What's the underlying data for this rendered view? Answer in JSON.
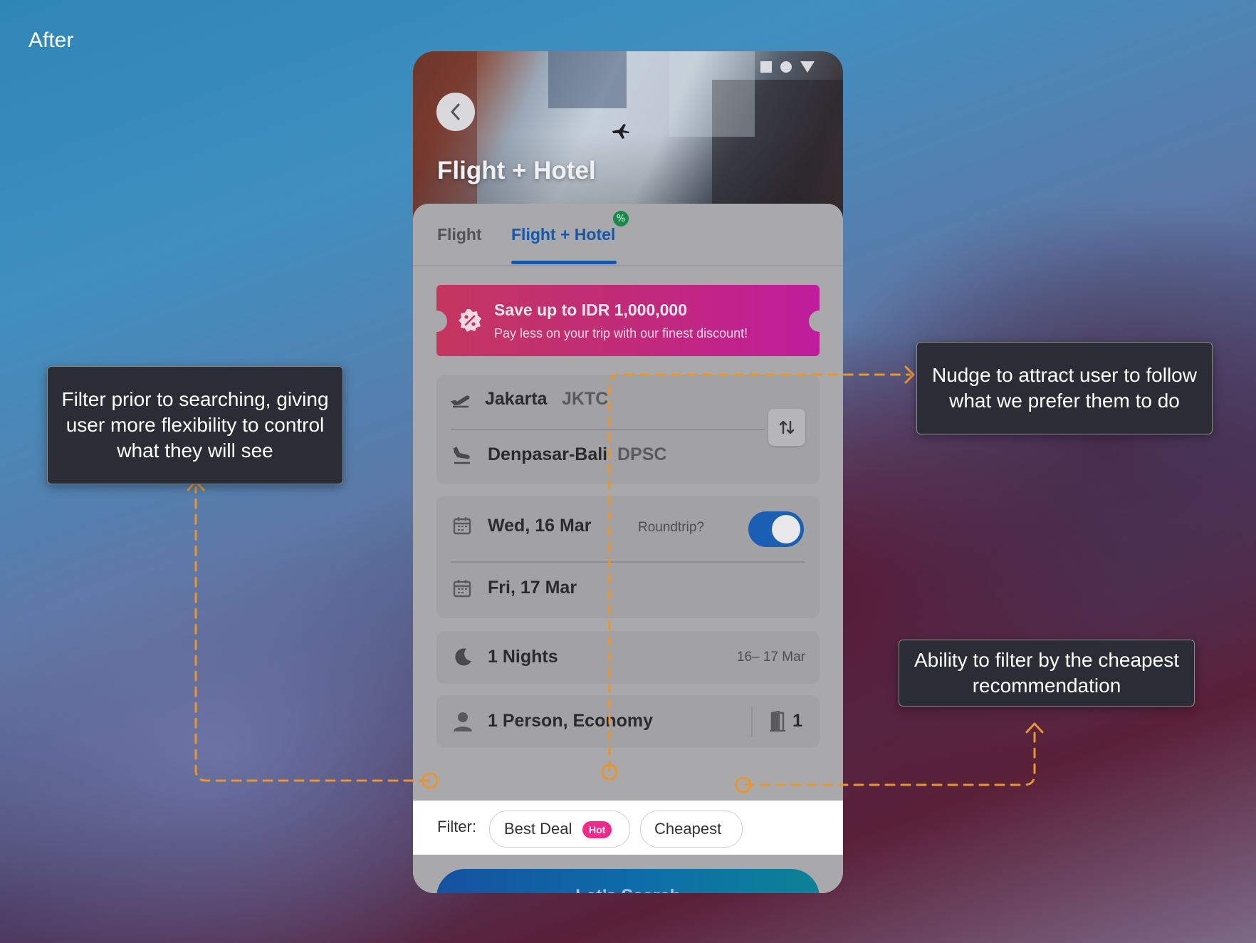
{
  "page_label": "After",
  "header": {
    "title": "Flight + Hotel",
    "status_icons": [
      "square-icon",
      "circle-icon",
      "triangle-icon"
    ]
  },
  "tabs": [
    {
      "label": "Flight",
      "active": false
    },
    {
      "label": "Flight + Hotel",
      "active": true
    }
  ],
  "promo": {
    "title": "Save up to IDR 1,000,000",
    "subtitle": "Pay less on your trip with our finest discount!"
  },
  "route": {
    "origin_city": "Jakarta",
    "origin_code": "JKTC",
    "destination_city": "Denpasar-Bali",
    "destination_code": "DPSC"
  },
  "dates": {
    "depart": "Wed, 16 Mar",
    "return": "Fri, 17 Mar",
    "roundtrip_label": "Roundtrip?",
    "roundtrip_enabled": true
  },
  "stay": {
    "nights": "1 Nights",
    "range": "16– 17 Mar"
  },
  "passengers": {
    "summary": "1 Person, Economy",
    "rooms": "1"
  },
  "filter": {
    "label": "Filter:",
    "options": [
      {
        "label": "Best Deal",
        "badge": "Hot"
      },
      {
        "label": "Cheapest"
      }
    ]
  },
  "search_button": "Let’s Search",
  "annotations": {
    "left": "Filter prior to searching, giving user more flexibility to control what they will see",
    "right_top": "Nudge to attract user to follow what we prefer them to do",
    "right_bottom": "Ability to filter by the cheapest recommendation"
  },
  "colors": {
    "accent": "#1557a8",
    "promo_start": "#c4365f",
    "promo_end": "#c01c9c",
    "hot_badge": "#f02a8a",
    "annotation_line": "#e8962e"
  }
}
